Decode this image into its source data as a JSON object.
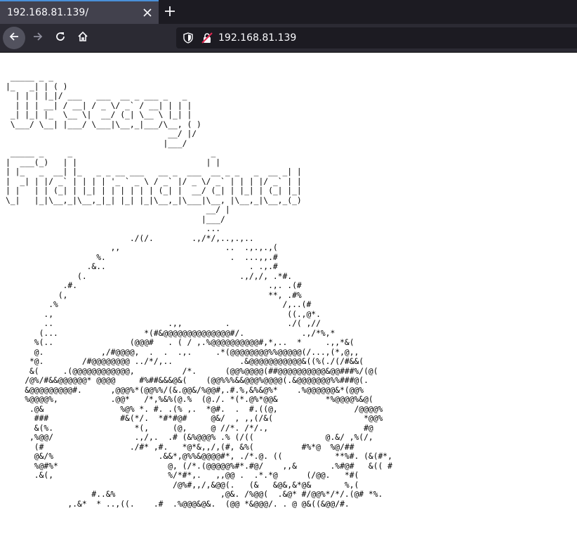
{
  "browser": {
    "tab": {
      "title": "192.168.81.139/",
      "close_icon": "close-icon"
    },
    "new_tab_icon": "plus-icon",
    "nav": {
      "back_icon": "arrow-left-icon",
      "forward_icon": "arrow-right-icon",
      "reload_icon": "reload-icon",
      "home_icon": "home-icon"
    },
    "url": {
      "shield_icon": "shield-icon",
      "insecure_lock_icon": "lock-insecure-icon",
      "text": "192.168.81.139"
    }
  },
  "page": {
    "ascii_art": " _____ _ _\n|_   _| | ( )\n  | | | |_|/ ___   ___  __ _ ___ _   _\n  | | | __| / __| / _ \\/ _` / __| | | |\n _| |_| |_  \\__ \\|  __/ (_| \\__ \\ |_| |\n \\___/ \\__| |___/ \\___|\\__,_|___/\\__, ( )\n                                  __/ |/\n                                 |___/\n _____ _     _                             _\n|  ___(_)   | |                           | |\n| |_   _  __| |_   _ _ __ ___   __ _  ___  __ _ _   _  __ _| |\n|  _| | |/ _` | | | | '_ ` _ \\ / _` |/ _ \\/ _` | | | |/ _` | |\n| |   | | (_| | |_| | | | | | | (_| |  __/ (_| | |_| | (_| |_|\n\\_|   |_|\\__,_|\\__,_|_| |_| |_|\\__,_|\\___|\\__, |\\__,_|\\__,_(_)\n                                          __/ |\n                                         |___/\n                                          ...\n                          ./(/.        .,/*/,..,.,..\n                      ,,                      ..  .,.,.,(\n                   %.                          .  ...,,.#\n                 .&..                              . .,.#\n               (.                                .,/,/, .*#.\n            .#.                                        .,. .(#\n           (,                                          **, .#%\n         .%                                               /,..(#\n        .,                                                 ((.,@*.\n        ..                        .,,         .            ./( ,//\n       (...                  *(#&@@@@@@@@@@@@@@#/.            .,/*%,*\n      %(..                (@@@#   . ( / ,.%@@@@@@@@@@#,*,..  *     .,,*&(\n      @.            ,/#@@@@,  .  .  .,.     .*(@@@@@@@@%%@@@@@(/...,(*,@,,\n     *@.        /#@@@@@@@@ ../*/,..              .&@@@@@@@@@@@&((%(./(/#&&(\n     &(     .(@@@@@@@@@@@@,          /*.      (@@%@@@@(##@@@@@@@@@@&@@###%/(@(\n    /@%/#&&@@@@@@* @@@@     #%##&&&@&(    (@@%%%&&@@@%@@@@(.&@@@@@@@%%###@(.\n    &@@@@@@@@@#.      ,@@@%*(@@%%/(&.@@&/%@@#,.#.%,&%&@%*    .%@@@@@@&*(@@%\n    %@@@@%,           .@@*   /*,%&%(@.%  (@./. *(*.@%*@@&          *%@@@@%&@(\n     .@&                %@% *. #. .(% ,.  *@#.  .  #.((@,                /@@@@%\n      ###               #&(*/.  *#*#@#     @&/  , ,,(/&(                   *@@%\n      &(%.                 *(,     (@,     @ //*. /*/.,                    #@\n     ,%@@/                 .,/,.  .# (&%@@@% .% (/((               @.&/ ,%(/,\n      (#                  ./#* ,#.   *@*&,,/,(#, &%(          #%*@  %@/##\n      @&/%                      .&&*,@%%&@@@@#*, ./*.@. ((           **%#. (&(#*,\n      %@#%*                       @, (/*.(@@@@@%#*.#@/    ,,&       .%#@#   &(( #\n      .&(,                        %/*#*,.   ,,@@ .  .*.*@      (/@@.   *#(\n                                   /@%#,,/,&@@(.   (&   &@&,&*@&       %,(\n                  #..&%                      ,@&. /%@@(  .&@* #/@@%*/*/.(@# *%.\n             ,.&*  * ..,((.    .#  .%@@@&@&.  (@@ *&@@@/. . @ @&((&@@/#."
  }
}
